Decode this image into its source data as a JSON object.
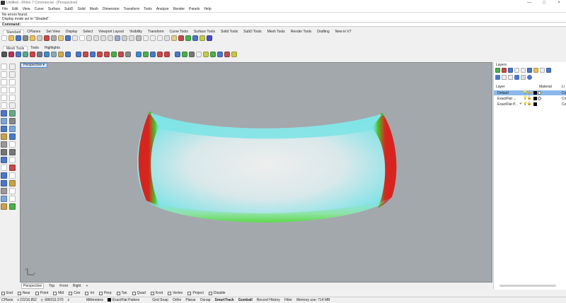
{
  "window": {
    "title": "Untitled - Rhino 7 Commercial - [Perspective]",
    "minimize": "—",
    "maximize": "□",
    "close": "×"
  },
  "menu": [
    "File",
    "Edit",
    "View",
    "Curve",
    "Surface",
    "SubD",
    "Solid",
    "Mesh",
    "Dimension",
    "Transform",
    "Tools",
    "Analyze",
    "Render",
    "Panels",
    "Help"
  ],
  "command_history": [
    "No errors found.",
    "Display mode set to \"Shaded\"."
  ],
  "command_prompt": "Command:",
  "toolbar_tabs_1": [
    "Standard",
    "CPlanes",
    "Set View",
    "Display",
    "Select",
    "Viewport Layout",
    "Visibility",
    "Transform",
    "Curve Tools",
    "Surface Tools",
    "Solid Tools",
    "SubD Tools",
    "Mesh Tools",
    "Render Tools",
    "Drafting",
    "New in V7"
  ],
  "toolbar_tabs_2": [
    "Mesh Tools",
    "Tools",
    "Highlights"
  ],
  "viewport": {
    "label": "Perspective",
    "menu_glyph": "▾",
    "axis_x": "x",
    "axis_y": "y"
  },
  "viewport_tabs": [
    "Perspective",
    "Top",
    "Front",
    "Right",
    "+"
  ],
  "osnaps": [
    "End",
    "Near",
    "Point",
    "Mid",
    "Cen",
    "Int",
    "Perp",
    "Tan",
    "Quad",
    "Knot",
    "Vertex",
    "Project",
    "Disable"
  ],
  "status": {
    "cplane": "CPlane",
    "x": "x 22216.852",
    "y": "y -686011.570",
    "z": "z",
    "units": "Millimeters",
    "layer": "ExactFlat Pattern",
    "toggles": [
      "Grid Snap",
      "Ortho",
      "Planar",
      "Osnap",
      "SmartTrack",
      "Gumball",
      "Record History",
      "Filter"
    ],
    "memory": "Memory use: 714 MB"
  },
  "layers_panel": {
    "title": "Layers",
    "col_layer": "Layer",
    "col_material": "Material",
    "col_linetype": "Li",
    "rows": [
      {
        "name": "Default",
        "selected": true,
        "check": "",
        "linetype": "Co"
      },
      {
        "name": "ExactFlat ...",
        "selected": false,
        "check": "",
        "linetype": "Co"
      },
      {
        "name": "ExactFlat P...",
        "selected": false,
        "check": "✓",
        "linetype": "Co"
      }
    ]
  },
  "colors": {
    "viewport_bg": "#a3a8ad",
    "selection": "#8cb8ec",
    "analysis_red": "#d8241f",
    "analysis_green": "#46c42b",
    "analysis_cyan": "#7fe3e6"
  }
}
